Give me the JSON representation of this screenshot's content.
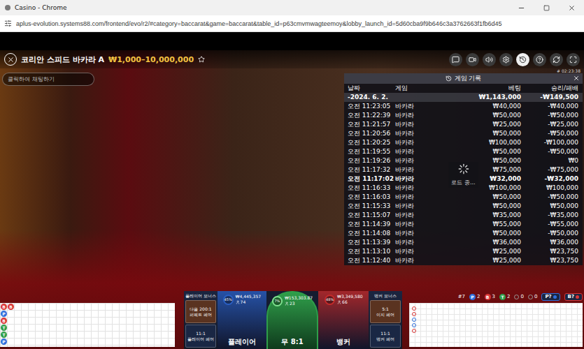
{
  "window": {
    "title": "Casino - Chrome"
  },
  "address_bar": {
    "url": "aplus-evolution.systems88.com/frontend/evo/r2/#category=baccarat&game=baccarat&table_id=p63cmvmwagteemoy&lobby_launch_id=5d60cba9f9b646c3a3762663f1fb6d45"
  },
  "game": {
    "title": "코리안 스피드 바카라 A",
    "limits": "₩1,000–10,000,000",
    "clock": "# 02:23:38"
  },
  "chat": {
    "placeholder": "클릭하여 채팅하기"
  },
  "toolbar": [
    {
      "selected": false
    },
    {
      "selected": false
    },
    {
      "selected": false
    },
    {
      "selected": false
    },
    {
      "selected": true
    },
    {
      "selected": false
    },
    {
      "selected": false
    },
    {
      "selected": false
    }
  ],
  "history": {
    "title": "게임 기록",
    "columns": [
      "날짜",
      "게임",
      "베팅",
      "승리/패배"
    ],
    "date_row": {
      "date": "-2024. 6. 2.",
      "bet": "₩1,143,000",
      "result": "-₩149,500"
    },
    "loading": "로드 중...",
    "rows": [
      {
        "time": "오전 11:23:05",
        "game": "바카라",
        "bet": "₩40,000",
        "result": "-₩40,000",
        "highlighted": false
      },
      {
        "time": "오전 11:22:39",
        "game": "바카라",
        "bet": "₩50,000",
        "result": "-₩50,000",
        "highlighted": false
      },
      {
        "time": "오전 11:21:57",
        "game": "바카라",
        "bet": "₩25,000",
        "result": "-₩25,000",
        "highlighted": false
      },
      {
        "time": "오전 11:20:56",
        "game": "바카라",
        "bet": "₩50,000",
        "result": "-₩50,000",
        "highlighted": false
      },
      {
        "time": "오전 11:20:25",
        "game": "바카라",
        "bet": "₩100,000",
        "result": "-₩100,000",
        "highlighted": false
      },
      {
        "time": "오전 11:19:55",
        "game": "바카라",
        "bet": "₩50,000",
        "result": "-₩50,000",
        "highlighted": false
      },
      {
        "time": "오전 11:19:26",
        "game": "바카라",
        "bet": "₩50,000",
        "result": "₩0",
        "highlighted": false
      },
      {
        "time": "오전 11:17:32",
        "game": "바카라",
        "bet": "₩75,000",
        "result": "-₩75,000",
        "highlighted": false
      },
      {
        "time": "오전 11:17:02",
        "game": "바카라",
        "bet": "₩32,000",
        "result": "-₩32,000",
        "highlighted": true
      },
      {
        "time": "오전 11:16:33",
        "game": "바카라",
        "bet": "₩100,000",
        "result": "₩100,000",
        "highlighted": false
      },
      {
        "time": "오전 11:16:03",
        "game": "바카라",
        "bet": "₩50,000",
        "result": "-₩50,000",
        "highlighted": false
      },
      {
        "time": "오전 11:15:33",
        "game": "바카라",
        "bet": "₩50,000",
        "result": "₩50,000",
        "highlighted": false
      },
      {
        "time": "오전 11:15:07",
        "game": "바카라",
        "bet": "₩35,000",
        "result": "-₩35,000",
        "highlighted": false
      },
      {
        "time": "오전 11:14:39",
        "game": "바카라",
        "bet": "₩55,000",
        "result": "-₩55,000",
        "highlighted": false
      },
      {
        "time": "오전 11:14:08",
        "game": "바카라",
        "bet": "₩50,000",
        "result": "-₩50,000",
        "highlighted": false
      },
      {
        "time": "오전 11:13:39",
        "game": "바카라",
        "bet": "₩36,000",
        "result": "₩36,000",
        "highlighted": false
      },
      {
        "time": "오전 11:13:10",
        "game": "바카라",
        "bet": "₩25,000",
        "result": "₩23,750",
        "highlighted": false
      },
      {
        "time": "오전 11:12:40",
        "game": "바카라",
        "bet": "₩25,000",
        "result": "₩23,750",
        "highlighted": false
      }
    ]
  },
  "bets": {
    "player_bonus": {
      "label": "플레이어 보너스",
      "top": {
        "odds": "다음 200:1",
        "name": "퍼펙트 페어"
      },
      "bottom": {
        "odds": "11:1",
        "name": "플레이어 페어"
      }
    },
    "player": {
      "label": "플레이어",
      "percent": "45%",
      "amount": "₩4,445,357",
      "players": "74",
      "color": "#2a5fc4"
    },
    "tie": {
      "label": "무 8:1",
      "percent": "7%",
      "amount": "₩153,303.87",
      "players": "23",
      "color": "#2f9e4a"
    },
    "banker": {
      "label": "뱅커",
      "percent": "48%",
      "amount": "₩3,349,580",
      "players": "66",
      "color": "#c62a2a"
    },
    "banker_bonus": {
      "label": "뱅커 보너스",
      "top": {
        "odds": "5:1",
        "name": "이지 페어"
      },
      "bottom": {
        "odds": "11:1",
        "name": "뱅커 페어"
      }
    }
  },
  "stats": [
    {
      "kind": "text",
      "text": "#7"
    },
    {
      "kind": "dot",
      "letter": "P",
      "count": "2",
      "color": "#2f6fdc"
    },
    {
      "kind": "dot",
      "letter": "B",
      "count": "3",
      "color": "#d93636"
    },
    {
      "kind": "dot",
      "letter": "T",
      "count": "2",
      "color": "#2f9e4a"
    },
    {
      "kind": "mark",
      "count": "0",
      "color": "#9a9a9a"
    },
    {
      "kind": "mark",
      "count": "0",
      "color": "#9a9a9a"
    },
    {
      "kind": "badge",
      "text": "P?",
      "color": "#2f6fdc"
    },
    {
      "kind": "badge",
      "text": "B?",
      "color": "#d93636"
    }
  ],
  "bead_road": [
    {
      "letter": "B",
      "color": "#d93636"
    },
    {
      "letter": "P",
      "color": "#2f6fdc"
    },
    {
      "letter": "B",
      "color": "#d93636"
    },
    {
      "letter": "T",
      "color": "#2f9e4a"
    },
    {
      "letter": "T",
      "color": "#2f9e4a"
    },
    {
      "letter": "P",
      "color": "#2f6fdc"
    },
    {
      "letter": "B",
      "color": "#d93636"
    }
  ],
  "big_road": [
    {
      "color": "#d93636"
    },
    {
      "color": "#d93636"
    },
    {
      "color": "#2f6fdc"
    },
    {
      "color": "#2f6fdc"
    },
    {
      "color": "#d93636"
    }
  ]
}
